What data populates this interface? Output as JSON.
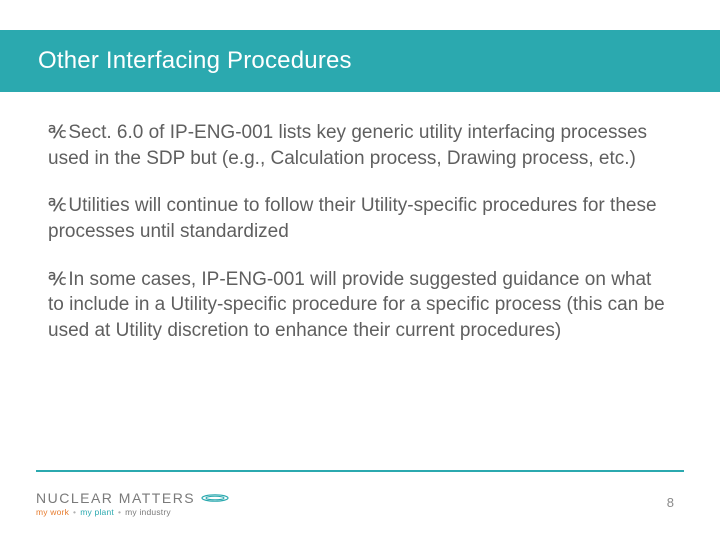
{
  "title": "Other Interfacing Procedures",
  "bullets": [
    "Sect. 6.0 of IP-ENG-001 lists key generic utility interfacing processes used in the SDP but (e.g., Calculation process, Drawing process, etc.)",
    "Utilities will continue to follow their Utility-specific procedures for these processes until standardized",
    "In some cases, IP-ENG-001 will provide suggested guidance on what to include in a Utility-specific procedure for a specific process (this can be used at Utility discretion to enhance their current procedures)"
  ],
  "logo": {
    "main": "NUCLEAR MATTERS",
    "tag_work": "my work",
    "tag_plant": "my plant",
    "tag_industry": "my industry",
    "dot": "•"
  },
  "page_number": "8"
}
